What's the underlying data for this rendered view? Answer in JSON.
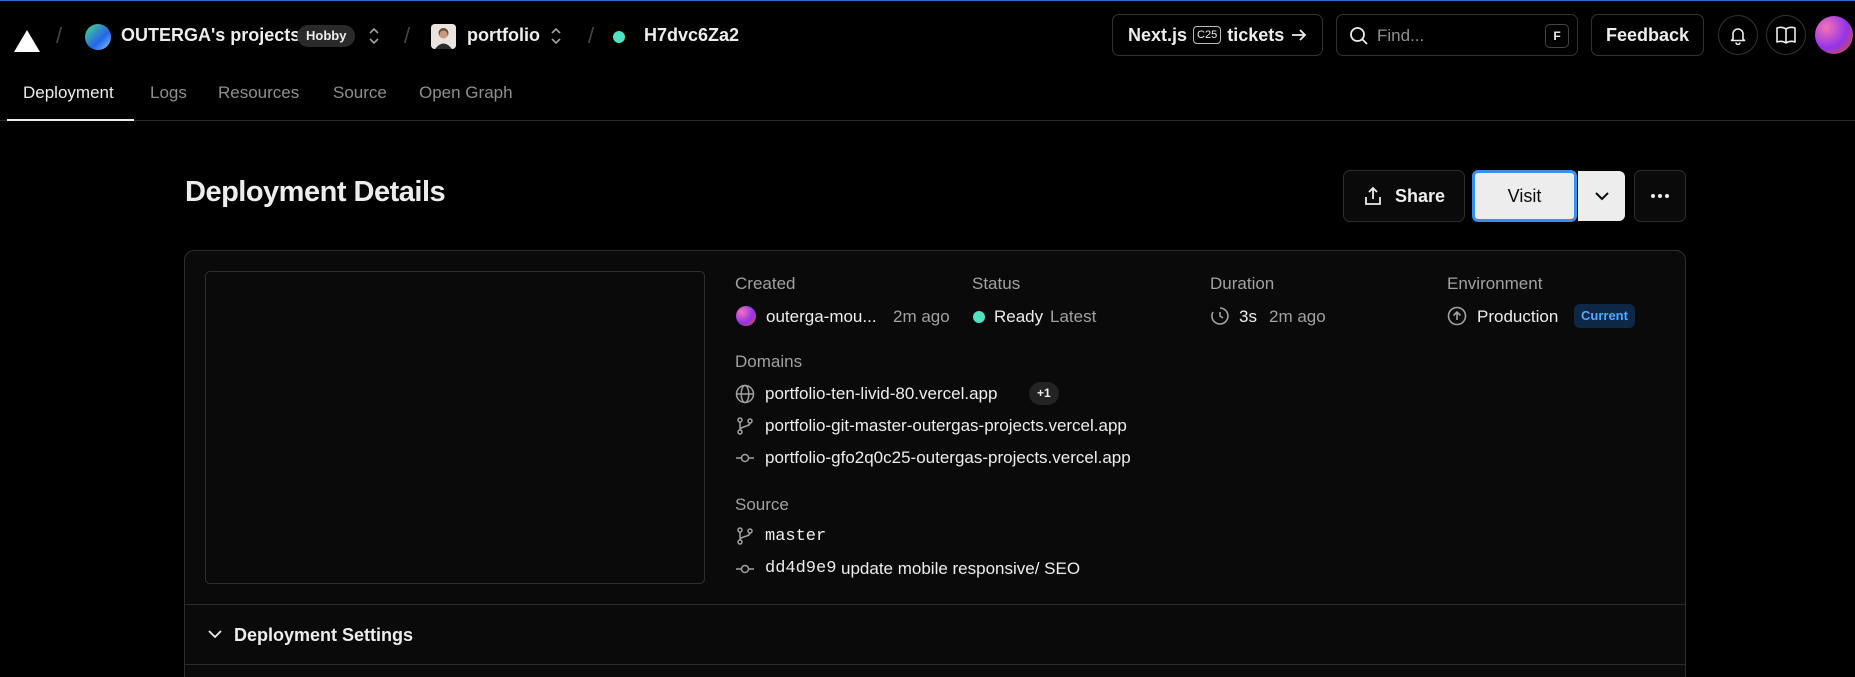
{
  "topbar": {
    "team_name": "OUTERGA's projects",
    "plan_badge": "Hobby",
    "project_name": "portfolio",
    "deployment_id": "H7dvc6Za2",
    "promo_prefix": "Next.js",
    "promo_badge": "C25",
    "promo_suffix": "tickets",
    "search_placeholder": "Find...",
    "search_shortcut": "F",
    "feedback_label": "Feedback"
  },
  "tabs": [
    "Deployment",
    "Logs",
    "Resources",
    "Source",
    "Open Graph"
  ],
  "page": {
    "title": "Deployment Details",
    "share_label": "Share",
    "visit_label": "Visit"
  },
  "details": {
    "created_label": "Created",
    "created_user": "outerga-mou...",
    "created_time": "2m ago",
    "status_label": "Status",
    "status_value": "Ready",
    "status_tag": "Latest",
    "duration_label": "Duration",
    "duration_value": "3s",
    "duration_time": "2m ago",
    "environment_label": "Environment",
    "environment_value": "Production",
    "environment_badge": "Current",
    "domains_label": "Domains",
    "domains": [
      "portfolio-ten-livid-80.vercel.app",
      "portfolio-git-master-outergas-projects.vercel.app",
      "portfolio-gfo2q0c25-outergas-projects.vercel.app"
    ],
    "domains_extra": "+1",
    "source_label": "Source",
    "branch": "master",
    "commit_hash": "dd4d9e9",
    "commit_message": "update mobile responsive/ SEO"
  },
  "settings": {
    "title": "Deployment Settings"
  },
  "colors": {
    "background": "#000000",
    "ready": "#50e3c2",
    "focus": "#3b8eea",
    "current_badge": "#52a8ff"
  }
}
